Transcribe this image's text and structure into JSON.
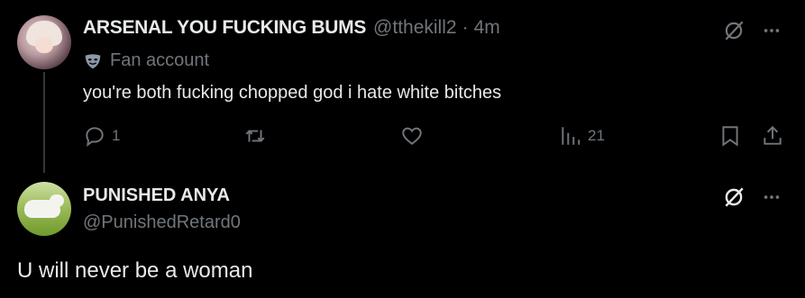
{
  "tweet1": {
    "display_name": "ARSENAL YOU FUCKING BUMS",
    "handle": "@tthekill2",
    "separator": "·",
    "time": "4m",
    "label": "Fan account",
    "text": "you're both fucking chopped god i hate white bitches",
    "replies": "1",
    "views": "21"
  },
  "tweet2": {
    "display_name": "PUNISHED ANYA",
    "handle": "@PunishedRetard0",
    "text": "U will never be a woman"
  },
  "colors": {
    "background": "#000000",
    "text": "#e7e9ea",
    "muted": "#71767b",
    "thread_line": "#333639"
  },
  "icons": [
    "grok-icon",
    "more-icon",
    "mask-icon",
    "reply-icon",
    "repost-icon",
    "like-icon",
    "views-icon",
    "bookmark-icon",
    "share-icon"
  ]
}
